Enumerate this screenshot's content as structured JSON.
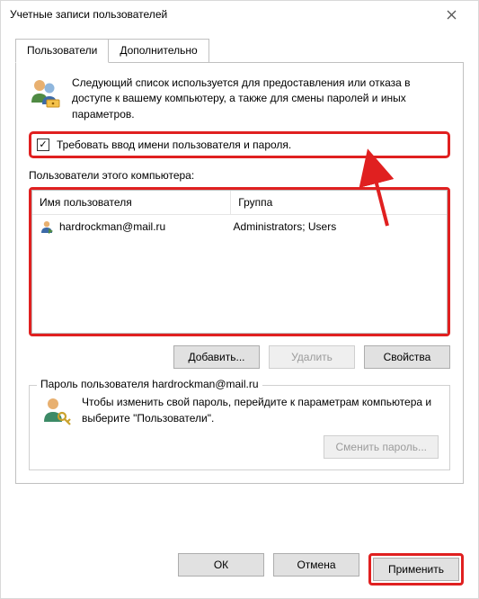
{
  "titlebar": {
    "title": "Учетные записи пользователей"
  },
  "tabs": {
    "users": "Пользователи",
    "advanced": "Дополнительно"
  },
  "intro_text": "Следующий список используется для предоставления или отказа в доступе к вашему компьютеру, а также для смены паролей и иных параметров.",
  "require_login": {
    "checked": true,
    "label": "Требовать ввод имени пользователя и пароля."
  },
  "users_label": "Пользователи этого компьютера:",
  "columns": {
    "user": "Имя пользователя",
    "group": "Группа"
  },
  "rows": [
    {
      "user": "hardrockman@mail.ru",
      "group": "Administrators; Users"
    }
  ],
  "buttons": {
    "add": "Добавить...",
    "remove": "Удалить",
    "props": "Свойства",
    "change_pwd": "Сменить пароль...",
    "ok": "ОК",
    "cancel": "Отмена",
    "apply": "Применить"
  },
  "pwd_group": {
    "legend": "Пароль пользователя hardrockman@mail.ru",
    "text": "Чтобы изменить свой пароль, перейдите к параметрам компьютера и выберите \"Пользователи\"."
  }
}
